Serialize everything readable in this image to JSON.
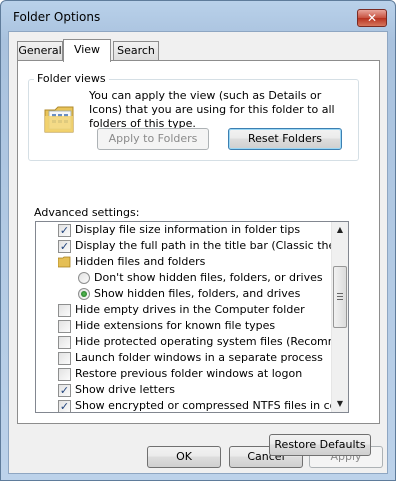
{
  "window": {
    "title": "Folder Options",
    "close_glyph": "✕"
  },
  "tabs": [
    "General",
    "View",
    "Search"
  ],
  "active_tab": "View",
  "folder_views": {
    "legend": "Folder views",
    "description": "You can apply the view (such as Details or Icons) that you are using for this folder to all folders of this type.",
    "icon": "folder-icon",
    "apply_button": "Apply to Folders",
    "reset_button": "Reset Folders"
  },
  "advanced": {
    "label": "Advanced settings:",
    "items": [
      {
        "type": "checkbox",
        "checked": true,
        "label": "Display file size information in folder tips"
      },
      {
        "type": "checkbox",
        "checked": true,
        "label": "Display the full path in the title bar (Classic theme only)"
      },
      {
        "type": "folder",
        "label": "Hidden files and folders"
      },
      {
        "type": "radio",
        "checked": false,
        "label": "Don't show hidden files, folders, or drives"
      },
      {
        "type": "radio",
        "checked": true,
        "label": "Show hidden files, folders, and drives"
      },
      {
        "type": "checkbox",
        "checked": false,
        "label": "Hide empty drives in the Computer folder"
      },
      {
        "type": "checkbox",
        "checked": false,
        "label": "Hide extensions for known file types"
      },
      {
        "type": "checkbox",
        "checked": false,
        "label": "Hide protected operating system files (Recommended)"
      },
      {
        "type": "checkbox",
        "checked": false,
        "label": "Launch folder windows in a separate process"
      },
      {
        "type": "checkbox",
        "checked": false,
        "label": "Restore previous folder windows at logon"
      },
      {
        "type": "checkbox",
        "checked": true,
        "label": "Show drive letters"
      },
      {
        "type": "checkbox",
        "checked": true,
        "label": "Show encrypted or compressed NTFS files in color"
      }
    ],
    "check_glyph": "✓",
    "scroll_up_glyph": "▲",
    "scroll_down_glyph": "▼"
  },
  "restore_defaults": "Restore Defaults",
  "footer": {
    "ok": "OK",
    "cancel": "Cancel",
    "apply": "Apply"
  }
}
